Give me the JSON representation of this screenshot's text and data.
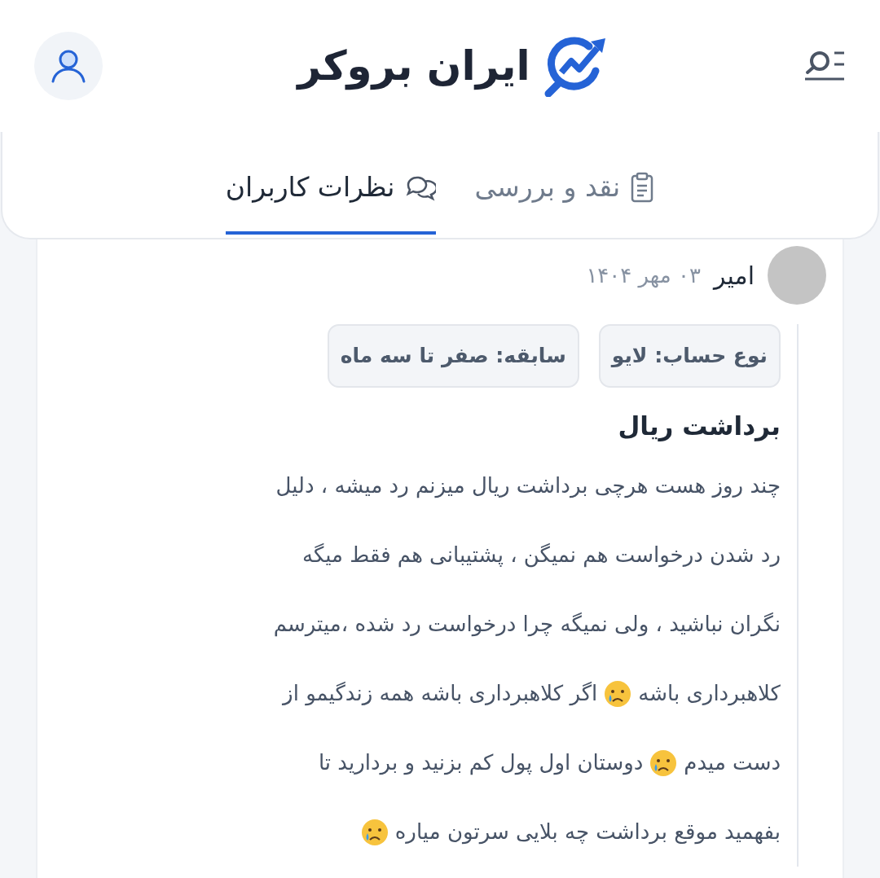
{
  "header": {
    "logo_text": "ایران بروکر"
  },
  "tabs": [
    {
      "label": "نقد و بررسی",
      "kind": "review",
      "selected": false
    },
    {
      "label": "نظرات کاربران",
      "kind": "comments",
      "selected": true
    }
  ],
  "comment": {
    "author": "امیر",
    "date": "۰۳ مهر ۱۴۰۴",
    "tags": [
      "نوع حساب: لایو",
      "سابقه: صفر تا سه ماه"
    ],
    "title": "برداشت ریال",
    "body_lines": [
      [
        {
          "kind": "text",
          "text": "چند روز هست هرچی برداشت ریال میزنم رد میشه ، دلیل"
        }
      ],
      [
        {
          "kind": "text",
          "text": "رد شدن درخواست هم نمیگن ، پشتیبانی هم فقط میگه"
        }
      ],
      [
        {
          "kind": "text",
          "text": "نگران نباشید ، ولی نمیگه چرا درخواست رد شده ،میترسم"
        }
      ],
      [
        {
          "kind": "text",
          "text": "کلاهبرداری باشه"
        },
        {
          "kind": "emoji"
        },
        {
          "kind": "text",
          "text": "اگر کلاهبرداری باشه همه زندگیمو از"
        }
      ],
      [
        {
          "kind": "text",
          "text": "دست میدم"
        },
        {
          "kind": "emoji"
        },
        {
          "kind": "text",
          "text": "دوستان اول پول کم بزنید و بردارید تا"
        }
      ],
      [
        {
          "kind": "text",
          "text": "بفهمید موقع برداشت چه بلایی سرتون میاره"
        },
        {
          "kind": "emoji"
        }
      ]
    ]
  }
}
